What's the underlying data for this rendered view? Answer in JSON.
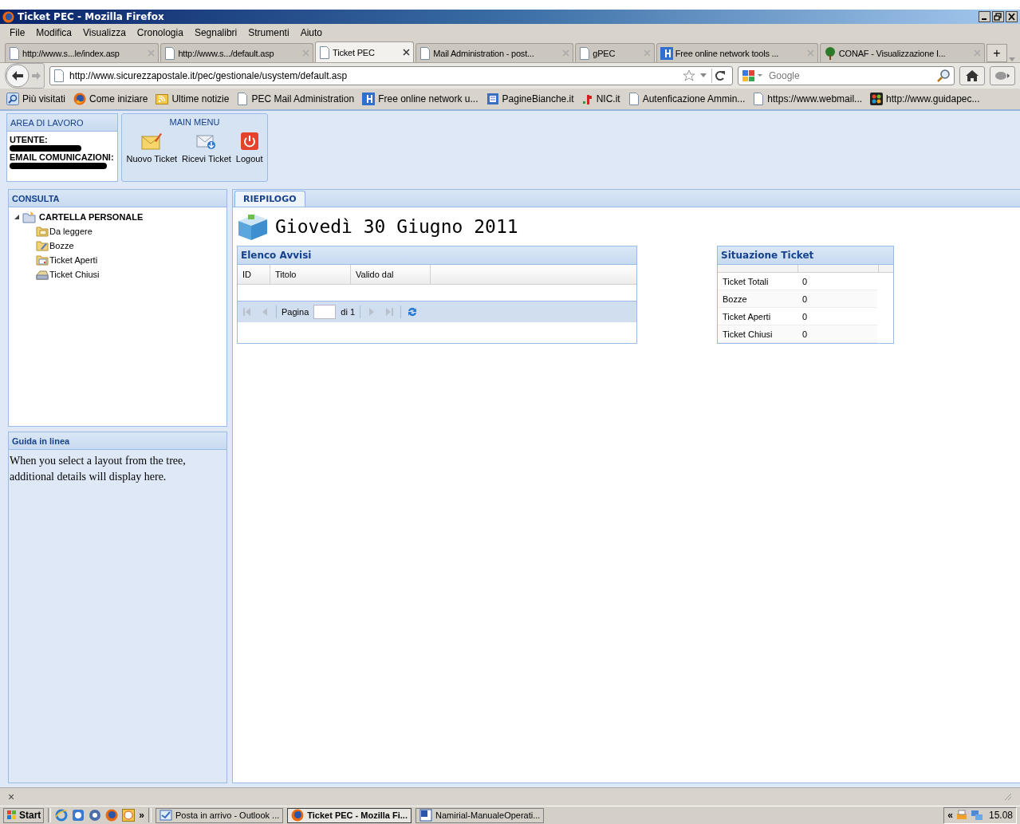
{
  "window": {
    "title": "Ticket PEC - Mozilla Firefox"
  },
  "menu": [
    "File",
    "Modifica",
    "Visualizza",
    "Cronologia",
    "Segnalibri",
    "Strumenti",
    "Aiuto"
  ],
  "tabs": [
    {
      "label": "http://www.s...le/index.asp",
      "kind": "page",
      "selected": false
    },
    {
      "label": "http://www.s.../default.asp",
      "kind": "page",
      "selected": false
    },
    {
      "label": "Ticket PEC",
      "kind": "page",
      "selected": true
    },
    {
      "label": "Mail Administration - post...",
      "kind": "page",
      "selected": false
    },
    {
      "label": "gPEC",
      "kind": "page",
      "selected": false
    },
    {
      "label": "Free online network tools ...",
      "kind": "h",
      "selected": false
    },
    {
      "label": "CONAF - Visualizzazione I...",
      "kind": "tree",
      "selected": false
    }
  ],
  "new_tab": "+",
  "nav": {
    "url": "http://www.sicurezzapostale.it/pec/gestionale/usystem/default.asp",
    "search_placeholder": "Google"
  },
  "bookmarks": [
    {
      "label": "Più visitati",
      "kind": "search"
    },
    {
      "label": "Come iniziare",
      "kind": "firefox"
    },
    {
      "label": "Ultime notizie",
      "kind": "rss"
    },
    {
      "label": "PEC Mail Administration",
      "kind": "page"
    },
    {
      "label": "Free online network u...",
      "kind": "h"
    },
    {
      "label": "PagineBianche.it",
      "kind": "pb"
    },
    {
      "label": "NIC.it",
      "kind": "nic"
    },
    {
      "label": "Autenficazione Ammin...",
      "kind": "page"
    },
    {
      "label": "https://www.webmail...",
      "kind": "page"
    },
    {
      "label": "http://www.guidapec...",
      "kind": "joomla"
    }
  ],
  "work_area": {
    "title": "AREA DI LAVORO",
    "fields": [
      {
        "label": "UTENTE:"
      },
      {
        "label": "EMAIL COMUNICAZIONI:"
      }
    ]
  },
  "main_menu": {
    "title": "MAIN MENU",
    "buttons": [
      {
        "label": "Nuovo Ticket",
        "kind": "new"
      },
      {
        "label": "Ricevi Ticket",
        "kind": "receive"
      },
      {
        "label": "Logout",
        "kind": "logout"
      }
    ]
  },
  "consulta": {
    "title": "CONSULTA",
    "tree": [
      {
        "label": "CARTELLA PERSONALE",
        "expanded": true,
        "children": [
          {
            "label": "Da leggere",
            "kind": "unread"
          },
          {
            "label": "Bozze",
            "kind": "draft"
          },
          {
            "label": "Ticket Aperti",
            "kind": "open"
          },
          {
            "label": "Ticket Chiusi",
            "kind": "closed"
          }
        ]
      }
    ]
  },
  "guide": {
    "title": "Guida in linea",
    "text": "When you select a layout from the tree, additional details will display here."
  },
  "content_tabs": [
    {
      "label": "RIEPILOGO",
      "selected": true
    }
  ],
  "date_heading": "Giovedì 30 Giugno 2011",
  "notices": {
    "title": "Elenco Avvisi",
    "columns": [
      "ID",
      "Titolo",
      "Valido dal"
    ],
    "pager": {
      "page_label": "Pagina",
      "page_total": "di 1",
      "buttons": [
        {
          "kind": "first",
          "disabled": true
        },
        {
          "kind": "prev",
          "disabled": true
        },
        {
          "kind": "next",
          "disabled": true
        },
        {
          "kind": "last",
          "disabled": true
        },
        {
          "kind": "refresh",
          "disabled": false
        }
      ]
    }
  },
  "ticket_status": {
    "title": "Situazione Ticket",
    "rows": [
      {
        "label": "Ticket Totali",
        "value": "0"
      },
      {
        "label": "Bozze",
        "value": "0"
      },
      {
        "label": "Ticket Aperti",
        "value": "0"
      },
      {
        "label": "Ticket Chiusi",
        "value": "0"
      }
    ]
  },
  "find_bar": {
    "close": "×"
  },
  "taskbar": {
    "start": "Start",
    "more": "»",
    "tasks": [
      {
        "label": "Posta in arrivo - Outlook ...",
        "kind": "outlook",
        "selected": false
      },
      {
        "label": "Ticket PEC - Mozilla Fi...",
        "kind": "firefox",
        "selected": true
      },
      {
        "label": "Namirial-ManualeOperati...",
        "kind": "word",
        "selected": false
      }
    ],
    "tray_toggle": "«",
    "clock": "15.08"
  }
}
